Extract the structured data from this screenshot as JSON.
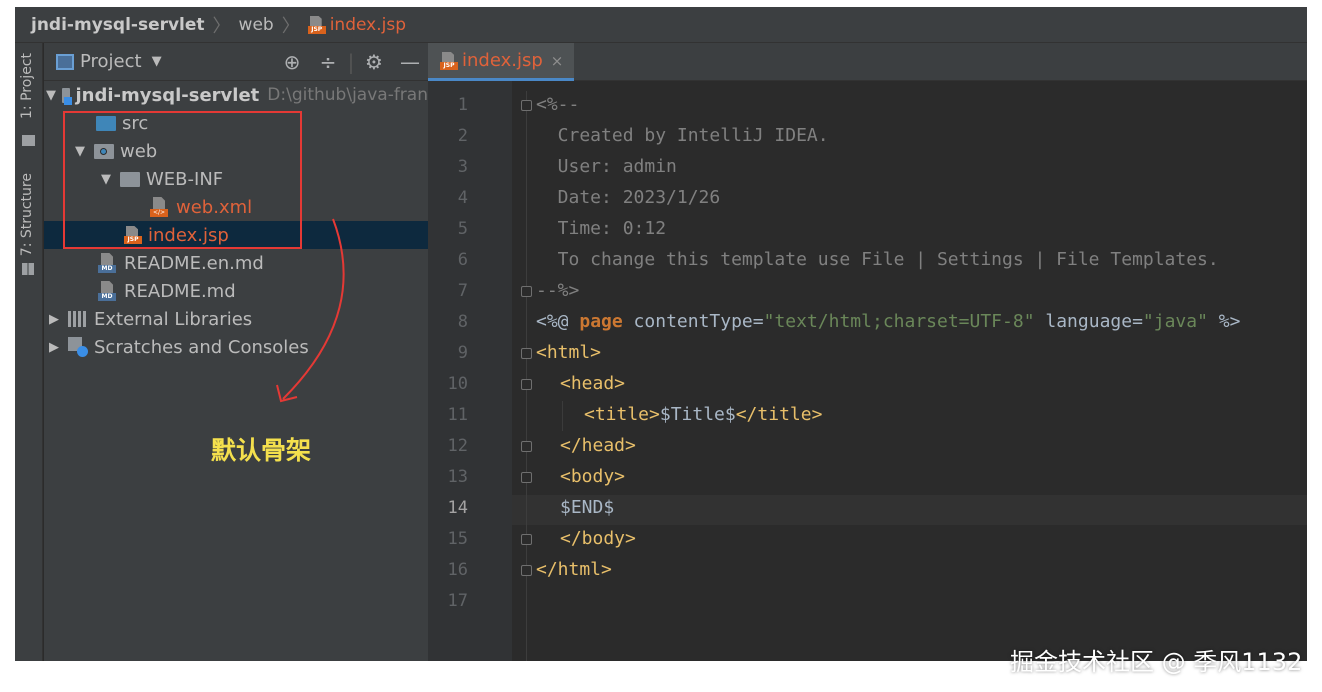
{
  "breadcrumb": {
    "project": "jndi-mysql-servlet",
    "folder": "web",
    "file": "index.jsp"
  },
  "toolstrip": {
    "project_tab": "1: Project",
    "structure_tab": "7: Structure"
  },
  "project_panel": {
    "title": "Project",
    "tree": [
      {
        "label": "jndi-mysql-servlet",
        "path": "D:\\github\\java-fran"
      },
      {
        "label": "src"
      },
      {
        "label": "web"
      },
      {
        "label": "WEB-INF"
      },
      {
        "label": "web.xml"
      },
      {
        "label": "index.jsp"
      },
      {
        "label": "README.en.md"
      },
      {
        "label": "README.md"
      },
      {
        "label": "External Libraries"
      },
      {
        "label": "Scratches and Consoles"
      }
    ]
  },
  "annotation": "默认骨架",
  "editor": {
    "tab_label": "index.jsp",
    "tab_close": "×",
    "active_line": 14,
    "line_numbers": [
      "1",
      "2",
      "3",
      "4",
      "5",
      "6",
      "7",
      "8",
      "9",
      "10",
      "11",
      "12",
      "13",
      "14",
      "15",
      "16",
      "17"
    ],
    "code": {
      "l1": "<%--",
      "l2": "  Created by IntelliJ IDEA.",
      "l3": "  User: admin",
      "l4": "  Date: 2023/1/26",
      "l5": "  Time: 0:12",
      "l6": "  To change this template use File | Settings | File Templates.",
      "l7": "--%>",
      "l8_open": "<%@ ",
      "l8_kw": "page",
      "l8_attr1": " contentType=",
      "l8_val1": "\"text/html;charset=UTF-8\"",
      "l8_attr2": " language=",
      "l8_val2": "\"java\"",
      "l8_close": " %>",
      "l9": "<html>",
      "l10": "<head>",
      "l11_open": "<title>",
      "l11_text": "$Title$",
      "l11_close": "</title>",
      "l12": "</head>",
      "l13": "<body>",
      "l14": "$END$",
      "l15": "</body>",
      "l16": "</html>"
    }
  },
  "watermark": "掘金技术社区 @ 季风1132",
  "colors": {
    "editor_bg": "#2b2b2b",
    "panel_bg": "#3c3f41",
    "selection": "#0d293e",
    "highlight_box": "#e53935",
    "annotation": "#f4e04d",
    "jsp_file": "#e0623a"
  }
}
